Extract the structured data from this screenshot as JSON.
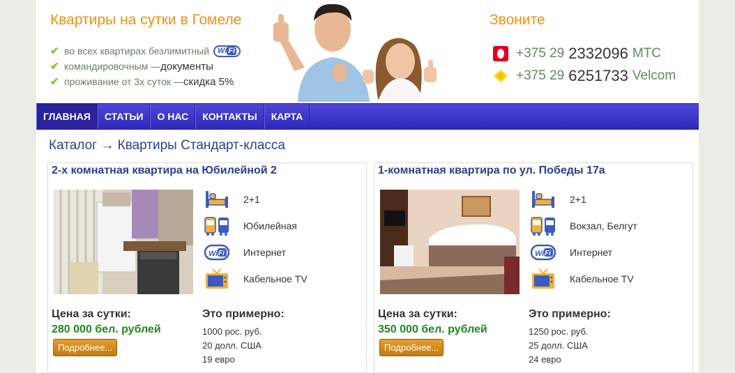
{
  "header": {
    "title": "Квартиры на сутки в Гомеле",
    "features": [
      {
        "text": "во всех квартирах безлимитный",
        "extra": ""
      },
      {
        "text": "командировочным — ",
        "extra": "документы"
      },
      {
        "text": "проживание от 3х суток — ",
        "extra": "скидка 5%"
      }
    ],
    "wifi_badge_a": "Wi",
    "wifi_badge_b": "Fi",
    "call_title": "Звоните",
    "phones": [
      {
        "prefix": "+375 29",
        "number": "2332096",
        "operator": "МТС",
        "icon": "mts-icon",
        "color": "#e2001a"
      },
      {
        "prefix": "+375 29",
        "number": "6251733",
        "operator": "Velcom",
        "icon": "velcom-icon",
        "color": "#ffd800"
      }
    ]
  },
  "nav": [
    "ГЛАВНАЯ",
    "СТАТЬИ",
    "О НАС",
    "КОНТАКТЫ",
    "КАРТА"
  ],
  "breadcrumb": "Каталог → Квартиры Стандарт-класса",
  "listings": [
    {
      "title": "2-х комнатная квартира на Юбилейной 2",
      "rooms": "2+1",
      "location": "Юбилейная",
      "internet": "Интернет",
      "tv": "Кабельное TV",
      "price_label": "Цена за сутки:",
      "price": "280 000 бел. рублей",
      "button": "Подробнее...",
      "approx_label": "Это примерно:",
      "approx": [
        "1000 рос. руб.",
        "20 долл. США",
        "19 евро"
      ]
    },
    {
      "title": "1-комнатная квартира по ул. Победы 17а",
      "rooms": "2+1",
      "location": "Вокзал, Белгут",
      "internet": "Интернет",
      "tv": "Кабельное TV",
      "price_label": "Цена за сутки:",
      "price": "350 000 бел. рублей",
      "button": "Подробнее...",
      "approx_label": "Это примерно:",
      "approx": [
        "1250 рос. руб.",
        "25 долл. США",
        "24 евро"
      ]
    }
  ],
  "amenity_wifi_label": "Wi Fi",
  "colors": {
    "accent": "#f09010",
    "nav": "#3a33c8",
    "link": "#2a3f8f",
    "price": "#1e8a1e"
  }
}
